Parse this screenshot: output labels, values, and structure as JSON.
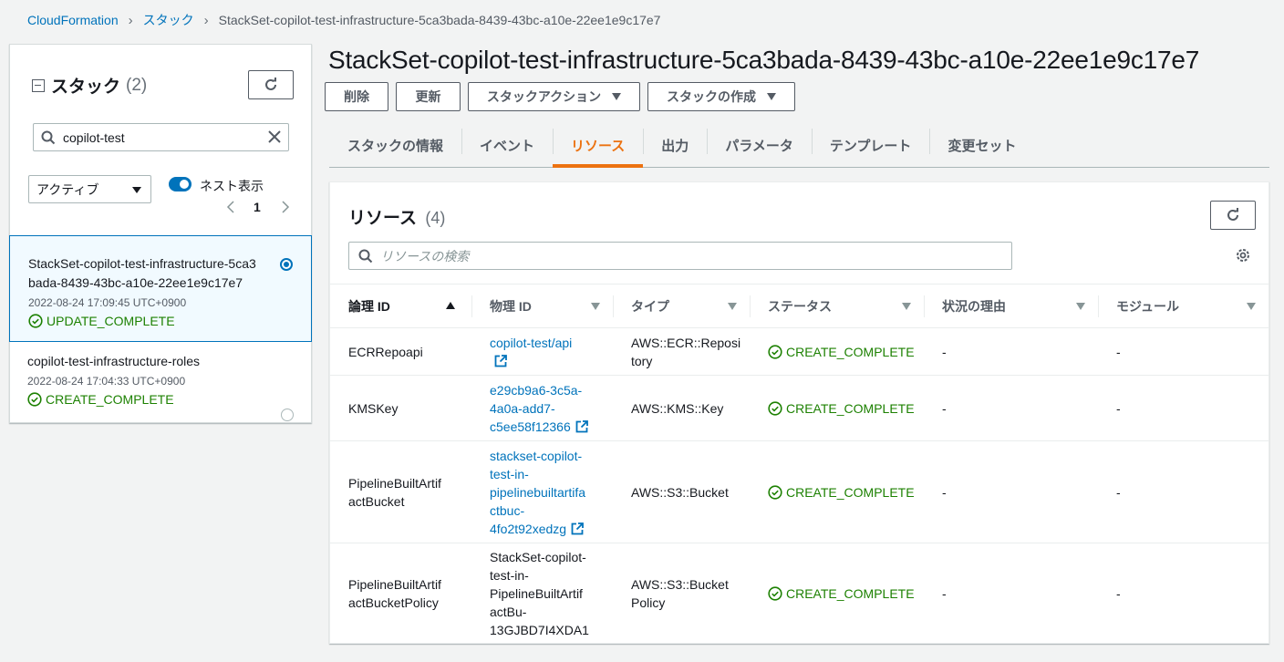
{
  "breadcrumb": {
    "items": [
      "CloudFormation",
      "スタック",
      "StackSet-copilot-test-infrastructure-5ca3bada-8439-43bc-a10e-22ee1e9c17e7"
    ]
  },
  "left_panel": {
    "title": "スタック",
    "count": "(2)",
    "search_value": "copilot-test",
    "filter_value": "アクティブ",
    "toggle_label": "ネスト表示",
    "page": "1",
    "stacks": [
      {
        "name_line1": "StackSet-copilot-test-infrastructure-5ca3",
        "name_line2": "bada-8439-43bc-a10e-22ee1e9c17e7",
        "date": "2022-08-24 17:09:45 UTC+0900",
        "status": "UPDATE_COMPLETE"
      },
      {
        "name_line1": "copilot-test-infrastructure-roles",
        "date": "2022-08-24 17:04:33 UTC+0900",
        "status": "CREATE_COMPLETE"
      }
    ]
  },
  "main": {
    "title": "StackSet-copilot-test-infrastructure-5ca3bada-8439-43bc-a10e-22ee1e9c17e7",
    "buttons": {
      "delete": "削除",
      "update": "更新",
      "stack_actions": "スタックアクション",
      "create_stack": "スタックの作成"
    },
    "tabs": [
      "スタックの情報",
      "イベント",
      "リソース",
      "出力",
      "パラメータ",
      "テンプレート",
      "変更セット"
    ],
    "active_tab": "リソース"
  },
  "resources": {
    "title": "リソース",
    "count": "(4)",
    "search_placeholder": "リソースの検索",
    "columns": [
      "論理 ID",
      "物理 ID",
      "タイプ",
      "ステータス",
      "状況の理由",
      "モジュール"
    ],
    "rows": [
      {
        "logical_id": [
          "ECRRepoapi"
        ],
        "physical_id": [
          "copilot-test/api"
        ],
        "physical_link": true,
        "type": [
          "AWS::ECR::Reposi",
          "tory"
        ],
        "status": "CREATE_COMPLETE",
        "reason": "-",
        "module": "-"
      },
      {
        "logical_id": [
          "KMSKey"
        ],
        "physical_id": [
          "e29cb9a6-3c5a-",
          "4a0a-add7-",
          "c5ee58f12366"
        ],
        "physical_link": true,
        "type": [
          "AWS::KMS::Key"
        ],
        "status": "CREATE_COMPLETE",
        "reason": "-",
        "module": "-"
      },
      {
        "logical_id": [
          "PipelineBuiltArtif",
          "actBucket"
        ],
        "physical_id": [
          "stackset-copilot-",
          "test-in-",
          "pipelinebuiltartifa",
          "ctbuc-",
          "4fo2t92xedzg"
        ],
        "physical_link": true,
        "type": [
          "AWS::S3::Bucket"
        ],
        "status": "CREATE_COMPLETE",
        "reason": "-",
        "module": "-"
      },
      {
        "logical_id": [
          "PipelineBuiltArtif",
          "actBucketPolicy"
        ],
        "physical_id": [
          "StackSet-copilot-",
          "test-in-",
          "PipelineBuiltArtif",
          "actBu-",
          "13GJBD7I4XDA1"
        ],
        "physical_link": false,
        "type": [
          "AWS::S3::Bucket",
          "Policy"
        ],
        "status": "CREATE_COMPLETE",
        "reason": "-",
        "module": "-"
      }
    ]
  },
  "colors": {
    "link": "#0073bb",
    "success": "#1d8102",
    "active_tab": "#ec7211",
    "background": "#f2f3f3"
  }
}
